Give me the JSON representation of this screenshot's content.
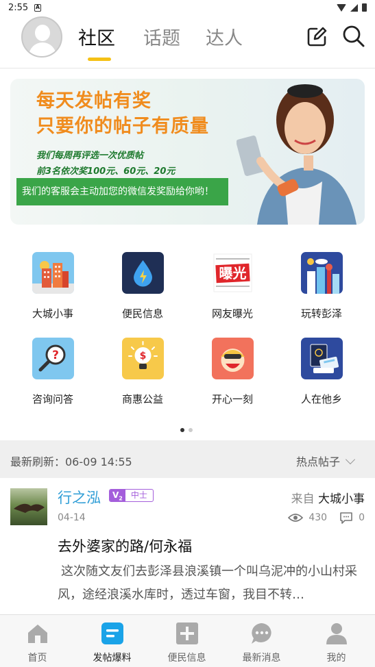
{
  "status_bar": {
    "time": "2:55"
  },
  "header": {
    "tabs": [
      {
        "label": "社区",
        "active": true
      },
      {
        "label": "话题",
        "active": false
      },
      {
        "label": "达人",
        "active": false
      }
    ]
  },
  "banner": {
    "line1": "每天发帖有奖",
    "line2": "只要你的帖子有质量",
    "line3": "我们每周再评选一次优质帖",
    "line4": "前3名依次奖100元、60元、20元",
    "green_text": "我们的客服会主动加您的微信发奖励给你哟！"
  },
  "categories": [
    {
      "label": "大城小事",
      "icon": "city-buildings-icon"
    },
    {
      "label": "便民信息",
      "icon": "water-drop-icon"
    },
    {
      "label": "网友曝光",
      "icon": "exposure-icon",
      "icon_text": "曝光"
    },
    {
      "label": "玩转彭泽",
      "icon": "city-skyline-icon"
    },
    {
      "label": "咨询问答",
      "icon": "question-magnifier-icon"
    },
    {
      "label": "商惠公益",
      "icon": "money-bulb-icon"
    },
    {
      "label": "开心一刻",
      "icon": "smiley-face-icon"
    },
    {
      "label": "人在他乡",
      "icon": "passport-icon"
    }
  ],
  "pager": {
    "pages": 2,
    "current": 1
  },
  "feed_header": {
    "refresh_label": "最新刷新：06-09 14:55",
    "sort_label": "热点帖子"
  },
  "post": {
    "author": "行之泓",
    "vip_level": "V",
    "vip_sub": "2",
    "rank": "中士",
    "source_prefix": "来自",
    "source_category": "大城小事",
    "date": "04-14",
    "views": "430",
    "comments": "0",
    "title": "去外婆家的路/何永福",
    "excerpt": "这次随文友们去彭泽县浪溪镇一个叫乌泥冲的小山村采风，途经浪溪水库时，透过车窗，我目不转…"
  },
  "tabbar": [
    {
      "label": "首页",
      "icon": "home-icon",
      "active": false
    },
    {
      "label": "发帖爆料",
      "icon": "post-icon",
      "active": true
    },
    {
      "label": "便民信息",
      "icon": "plus-square-icon",
      "active": false
    },
    {
      "label": "最新消息",
      "icon": "message-bubble-icon",
      "active": false
    },
    {
      "label": "我的",
      "icon": "user-icon",
      "active": false
    }
  ],
  "colors": {
    "accent_yellow": "#f5c116",
    "author_blue": "#2e9dd6",
    "vip_purple": "#a45edb",
    "active_tab_blue": "#1aa3e8",
    "banner_orange": "#f08c1e",
    "banner_green": "#3aa548"
  }
}
